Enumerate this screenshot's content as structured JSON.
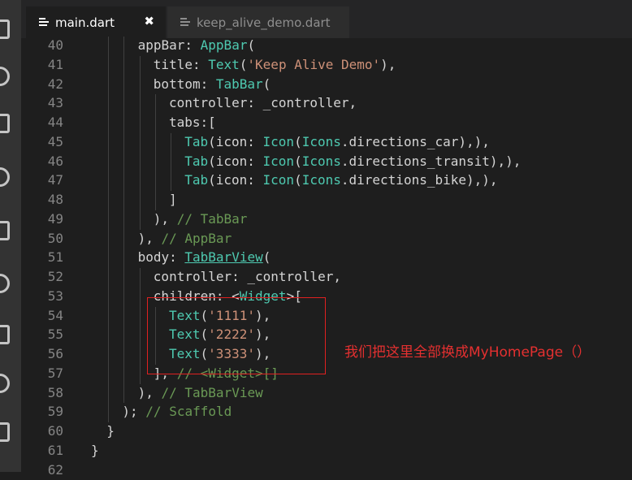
{
  "tabs": [
    {
      "label": "main.dart",
      "active": true,
      "close": "✖"
    },
    {
      "label": "keep_alive_demo.dart",
      "active": false
    }
  ],
  "lines": [
    {
      "n": "40",
      "indent": 3,
      "tokens": [
        [
          "plain",
          "appBar: "
        ],
        [
          "type",
          "AppBar"
        ],
        [
          "plain",
          "("
        ]
      ]
    },
    {
      "n": "41",
      "indent": 4,
      "tokens": [
        [
          "plain",
          "title: "
        ],
        [
          "type",
          "Text"
        ],
        [
          "plain",
          "("
        ],
        [
          "str",
          "'Keep Alive Demo'"
        ],
        [
          "plain",
          "),"
        ]
      ]
    },
    {
      "n": "42",
      "indent": 4,
      "tokens": [
        [
          "plain",
          "bottom: "
        ],
        [
          "type",
          "TabBar"
        ],
        [
          "plain",
          "("
        ]
      ]
    },
    {
      "n": "43",
      "indent": 5,
      "tokens": [
        [
          "plain",
          "controller: _controller,"
        ]
      ]
    },
    {
      "n": "44",
      "indent": 5,
      "tokens": [
        [
          "plain",
          "tabs:["
        ]
      ]
    },
    {
      "n": "45",
      "indent": 6,
      "tokens": [
        [
          "type",
          "Tab"
        ],
        [
          "plain",
          "(icon: "
        ],
        [
          "type",
          "Icon"
        ],
        [
          "plain",
          "("
        ],
        [
          "type",
          "Icons"
        ],
        [
          "plain",
          ".directions_car),),"
        ]
      ]
    },
    {
      "n": "46",
      "indent": 6,
      "tokens": [
        [
          "type",
          "Tab"
        ],
        [
          "plain",
          "(icon: "
        ],
        [
          "type",
          "Icon"
        ],
        [
          "plain",
          "("
        ],
        [
          "type",
          "Icons"
        ],
        [
          "plain",
          ".directions_transit),),"
        ]
      ]
    },
    {
      "n": "47",
      "indent": 6,
      "tokens": [
        [
          "type",
          "Tab"
        ],
        [
          "plain",
          "(icon: "
        ],
        [
          "type",
          "Icon"
        ],
        [
          "plain",
          "("
        ],
        [
          "type",
          "Icons"
        ],
        [
          "plain",
          ".directions_bike),),"
        ]
      ]
    },
    {
      "n": "48",
      "indent": 5,
      "tokens": [
        [
          "plain",
          "]"
        ]
      ]
    },
    {
      "n": "49",
      "indent": 4,
      "tokens": [
        [
          "plain",
          "), "
        ],
        [
          "com",
          "// TabBar"
        ]
      ]
    },
    {
      "n": "50",
      "indent": 3,
      "tokens": [
        [
          "plain",
          "), "
        ],
        [
          "com",
          "// AppBar"
        ]
      ]
    },
    {
      "n": "51",
      "indent": 3,
      "tokens": [
        [
          "plain",
          "body: "
        ],
        [
          "link",
          "TabBarView"
        ],
        [
          "plain",
          "("
        ]
      ]
    },
    {
      "n": "52",
      "indent": 4,
      "tokens": [
        [
          "plain",
          "controller: _controller,"
        ]
      ]
    },
    {
      "n": "53",
      "indent": 4,
      "tokens": [
        [
          "plain",
          "children: <"
        ],
        [
          "type",
          "Widget"
        ],
        [
          "plain",
          ">["
        ]
      ]
    },
    {
      "n": "54",
      "indent": 5,
      "tokens": [
        [
          "type",
          "Text"
        ],
        [
          "plain",
          "("
        ],
        [
          "str",
          "'1111'"
        ],
        [
          "plain",
          "),"
        ]
      ]
    },
    {
      "n": "55",
      "indent": 5,
      "tokens": [
        [
          "type",
          "Text"
        ],
        [
          "plain",
          "("
        ],
        [
          "str",
          "'2222'"
        ],
        [
          "plain",
          "),"
        ]
      ]
    },
    {
      "n": "56",
      "indent": 5,
      "tokens": [
        [
          "type",
          "Text"
        ],
        [
          "plain",
          "("
        ],
        [
          "str",
          "'3333'"
        ],
        [
          "plain",
          "),"
        ]
      ]
    },
    {
      "n": "57",
      "indent": 4,
      "tokens": [
        [
          "plain",
          "], "
        ],
        [
          "com",
          "// <Widget>[]"
        ]
      ]
    },
    {
      "n": "58",
      "indent": 3,
      "tokens": [
        [
          "plain",
          "), "
        ],
        [
          "com",
          "// TabBarView"
        ]
      ]
    },
    {
      "n": "59",
      "indent": 2,
      "tokens": [
        [
          "plain",
          "); "
        ],
        [
          "com",
          "// Scaffold"
        ]
      ]
    },
    {
      "n": "60",
      "indent": 1,
      "tokens": [
        [
          "plain",
          "}"
        ]
      ]
    },
    {
      "n": "61",
      "indent": 0,
      "tokens": [
        [
          "plain",
          "}"
        ]
      ]
    },
    {
      "n": "62",
      "indent": 0,
      "tokens": []
    }
  ],
  "annotation": "我们把这里全部换成MyHomePage（）",
  "activity_icons": [
    "explorer-icon",
    "search-icon",
    "source-control-icon",
    "debug-icon",
    "extensions-icon",
    "flask-icon",
    "copy-icon",
    "remote-icon",
    "account-icon"
  ],
  "colors": {
    "background": "#1e1e1e",
    "keyword_type": "#4ec9b0",
    "string": "#ce9178",
    "comment": "#6a9955",
    "annotation": "#e43030"
  }
}
